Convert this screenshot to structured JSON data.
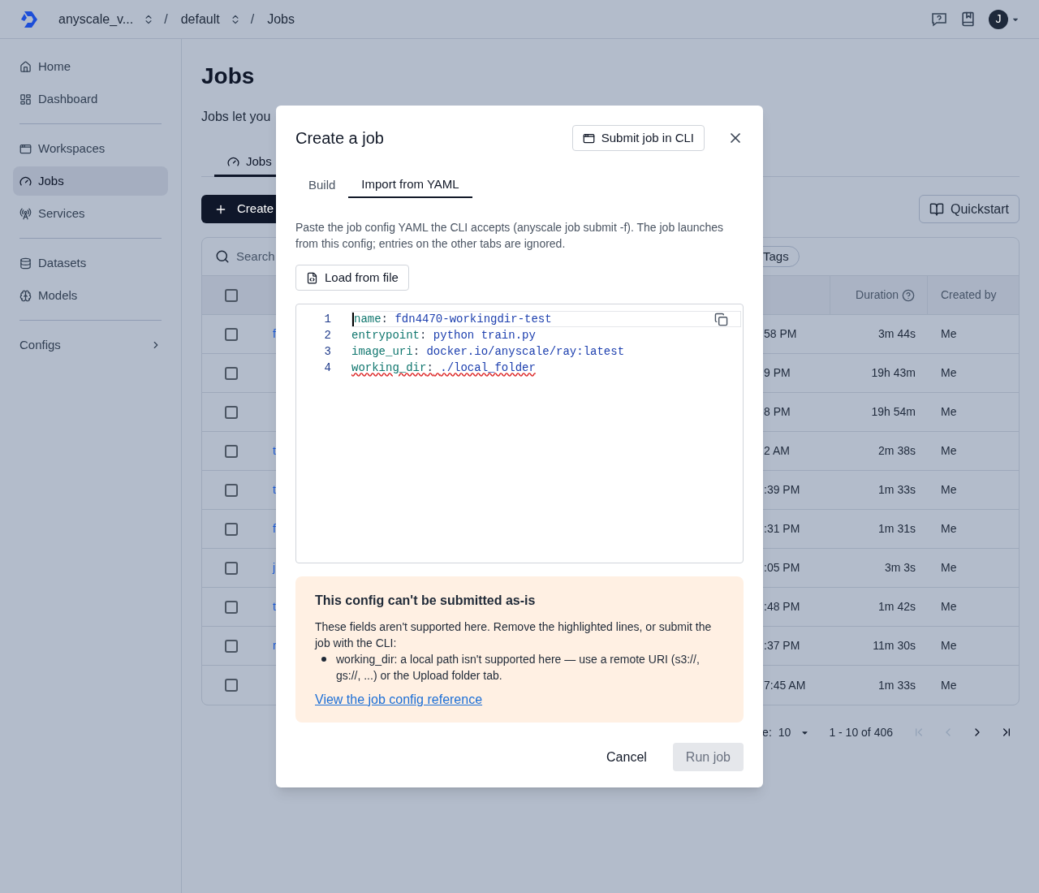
{
  "topbar": {
    "breadcrumbs": [
      {
        "label": "anyscale_v...",
        "switcher": true,
        "separator": "/"
      },
      {
        "label": "default",
        "switcher": true,
        "separator": "/"
      },
      {
        "label": "Jobs",
        "switcher": false
      }
    ],
    "avatar": "J"
  },
  "sidebar": {
    "groups": [
      [
        {
          "label": "Home",
          "kind": "home",
          "selected": false
        },
        {
          "label": "Dashboard",
          "kind": "dashboard",
          "selected": false
        }
      ],
      [
        {
          "label": "Workspaces",
          "kind": "workspaces",
          "selected": false
        },
        {
          "label": "Jobs",
          "kind": "jobs",
          "selected": true
        },
        {
          "label": "Services",
          "kind": "services",
          "selected": false
        }
      ],
      [
        {
          "label": "Datasets",
          "kind": "datasets",
          "selected": false
        },
        {
          "label": "Models",
          "kind": "models",
          "selected": false
        }
      ],
      [
        {
          "label": "Configs",
          "kind": "expandable",
          "selected": false
        }
      ]
    ]
  },
  "page": {
    "title": "Jobs",
    "description": "Jobs let you",
    "tabs": [
      {
        "label": "Jobs",
        "selected": true
      }
    ],
    "create_button": "Create",
    "quickstart_button": "Quickstart",
    "search": {
      "placeholder": "Search"
    },
    "filter_chip": "Tags",
    "table": {
      "all_checked": false,
      "columns": [
        "Duration",
        "Created by"
      ],
      "rows": [
        {
          "checked": false,
          "column_2": "f",
          "column_3": "58 PM",
          "duration": "3m 44s",
          "created_by": "Me"
        },
        {
          "checked": false,
          "column_3": "9 PM",
          "duration": "19h 43m",
          "created_by": "Me"
        },
        {
          "checked": false,
          "column_3": "8 PM",
          "duration": "19h 54m",
          "created_by": "Me"
        },
        {
          "checked": false,
          "column_2": "t",
          "column_3": "2 AM",
          "duration": "2m 38s",
          "created_by": "Me"
        },
        {
          "checked": false,
          "column_2": "t",
          "column_3": ":39 PM",
          "duration": "1m 33s",
          "created_by": "Me"
        },
        {
          "checked": false,
          "column_2": "f",
          "column_3": ":31 PM",
          "duration": "1m 31s",
          "created_by": "Me"
        },
        {
          "checked": false,
          "column_2": "j",
          "column_3": ":05 PM",
          "duration": "3m 3s",
          "created_by": "Me"
        },
        {
          "checked": false,
          "column_2": "t",
          "column_3": ":48 PM",
          "duration": "1m 42s",
          "created_by": "Me"
        },
        {
          "checked": false,
          "column_2": "r",
          "column_3": ":37 PM",
          "duration": "11m 30s",
          "created_by": "Me"
        },
        {
          "checked": false,
          "column_3": "7:45 AM",
          "duration": "1m 33s",
          "created_by": "Me"
        }
      ]
    },
    "pagination": {
      "page_size_label": "e:",
      "page_size": "10",
      "range": "1 - 10 of 406",
      "nav": [
        {
          "kind": "first",
          "disabled": true
        },
        {
          "kind": "prev",
          "disabled": true
        },
        {
          "kind": "next",
          "disabled": false
        },
        {
          "kind": "last",
          "disabled": false
        }
      ]
    }
  },
  "modal": {
    "title": "Create a job",
    "cli_button": "Submit job in CLI",
    "tabs": [
      {
        "label": "Build",
        "selected": false
      },
      {
        "label": "Import from YAML",
        "selected": true
      }
    ],
    "description": "Paste the job config YAML the CLI accepts (anyscale job submit -f). The job launches from this config; entries on the other tabs are ignored.",
    "load_button": "Load from file",
    "editor": {
      "lines": [
        {
          "number": "1",
          "key": "name",
          "punct": ":",
          "value": "fdn4470-workingdir-test",
          "active": true,
          "error": false
        },
        {
          "number": "2",
          "key": "entrypoint",
          "punct": ":",
          "value": "python train.py",
          "active": false,
          "error": false
        },
        {
          "number": "3",
          "key": "image_uri",
          "punct": ":",
          "value": "docker.io/anyscale/ray:latest",
          "active": false,
          "error": false
        },
        {
          "number": "4",
          "key": "working_dir",
          "punct": ":",
          "value": "./local_folder",
          "active": false,
          "error": true
        }
      ]
    },
    "warning": {
      "title": "This config can't be submitted as-is",
      "body": "These fields aren't supported here. Remove the highlighted lines, or submit the job with the CLI:",
      "bullets": [
        "working_dir: a local path isn't supported here — use a remote URI (s3://, gs://, ...) or the Upload folder tab."
      ],
      "link": "View the job config reference"
    },
    "cancel_button": "Cancel",
    "run_button": {
      "label": "Run job",
      "disabled": true
    }
  }
}
